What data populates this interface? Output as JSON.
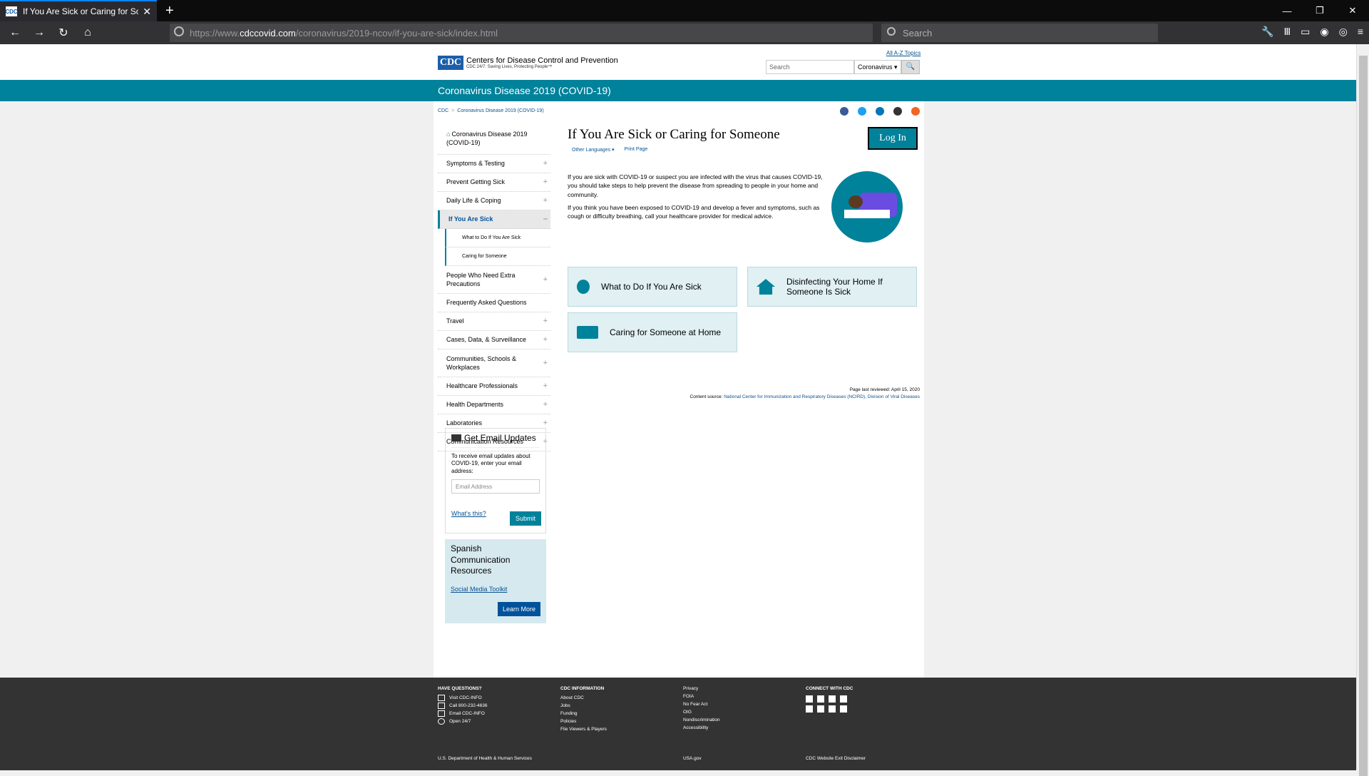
{
  "browser": {
    "tab_title": "If You Are Sick or Caring for So",
    "url_prefix": "https://www.",
    "url_domain": "cdccovid.com",
    "url_path": "/coronavirus/2019-ncov/if-you-are-sick/index.html",
    "search_placeholder": "Search",
    "favicon_text": "CDC"
  },
  "header": {
    "logo_text": "CDC",
    "org_name": "Centers for Disease Control and Prevention",
    "tagline": "CDC 24/7: Saving Lives, Protecting People™",
    "az_link": "All A-Z Topics",
    "search_placeholder": "Search",
    "search_scope": "Coronavirus",
    "search_button": "🔍"
  },
  "banner": {
    "title": "Coronavirus Disease 2019 (COVID-19)"
  },
  "breadcrumb": {
    "items": [
      "CDC",
      "Coronavirus Disease 2019 (COVID-19)"
    ]
  },
  "sidenav": {
    "home": "Coronavirus Disease 2019 (COVID-19)",
    "items": [
      {
        "label": "Symptoms & Testing"
      },
      {
        "label": "Prevent Getting Sick"
      },
      {
        "label": "Daily Life & Coping"
      },
      {
        "label": "If You Are Sick"
      },
      {
        "label": "What to Do If You Are Sick"
      },
      {
        "label": "Caring for Someone"
      },
      {
        "label": "People Who Need Extra Precautions"
      },
      {
        "label": "Frequently Asked Questions"
      },
      {
        "label": "Travel"
      },
      {
        "label": "Cases, Data, & Surveillance"
      },
      {
        "label": "Communities, Schools & Workplaces"
      },
      {
        "label": "Healthcare Professionals"
      },
      {
        "label": "Health Departments"
      },
      {
        "label": "Laboratories"
      },
      {
        "label": "Communication Resources"
      }
    ],
    "plus": "+",
    "minus": "–"
  },
  "email_box": {
    "title": "Get Email Updates",
    "text": "To receive email updates about COVID-19, enter your email address:",
    "placeholder": "Email Address",
    "whats_this": "What's this?",
    "submit": "Submit"
  },
  "spanish_box": {
    "title": "Spanish Communication Resources",
    "link": "Social Media Toolkit",
    "button": "Learn More"
  },
  "main": {
    "title": "If You Are Sick or Caring for Someone",
    "login": "Log In",
    "other_languages": "Other Languages ▾",
    "print_page": "Print Page",
    "para1": "If you are sick with COVID-19 or suspect you are infected with the virus that causes COVID-19, you should take steps to help prevent the disease from spreading to people in your home and community.",
    "para2": "If you think you have been exposed to COVID-19 and develop a fever and symptoms, such as cough or difficulty breathing, call your healthcare provider for medical advice.",
    "cards": [
      {
        "label": "What to Do If You Are Sick",
        "icon": "sick-person-icon"
      },
      {
        "label": "Disinfecting Your Home If Someone Is Sick",
        "icon": "house-icon"
      },
      {
        "label": "Caring for Someone at Home",
        "icon": "bed-icon"
      }
    ],
    "reviewed": "Page last reviewed: April 15, 2020",
    "source_prefix": "Content source: ",
    "source_link": "National Center for Immunization and Respiratory Diseases (NCIRD), Division of Viral Diseases"
  },
  "footer": {
    "questions_head": "HAVE QUESTIONS?",
    "questions": [
      "Visit CDC-INFO",
      "Call 800-232-4636",
      "Email CDC-INFO",
      "Open 24/7"
    ],
    "info_head": "CDC INFORMATION",
    "info": [
      "About CDC",
      "Jobs",
      "Funding",
      "Policies",
      "File Viewers & Players"
    ],
    "policy": [
      "Privacy",
      "FOIA",
      "No Fear Act",
      "OIG",
      "Nondiscrimination",
      "Accessibility"
    ],
    "connect_head": "CONNECT WITH CDC",
    "hhs": "U.S. Department of Health & Human Services",
    "usagov": "USA.gov",
    "disclaimer": "CDC Website Exit Disclaimer"
  },
  "colors": {
    "teal": "#00829b",
    "navy": "#1c5ea8",
    "link": "#075290",
    "footer": "#333333"
  }
}
